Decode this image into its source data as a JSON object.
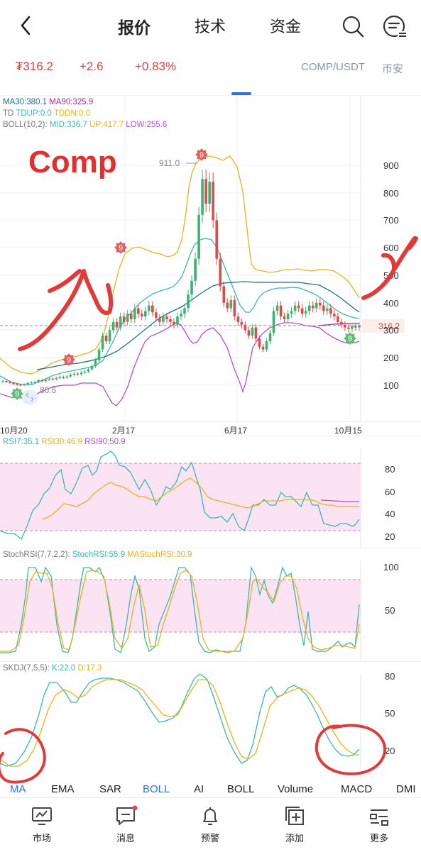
{
  "header": {
    "tabs": [
      {
        "label": "报价",
        "active": true
      },
      {
        "label": "技术",
        "active": false
      },
      {
        "label": "资金",
        "active": false
      }
    ]
  },
  "ticker": {
    "price": "₮316.2",
    "change": "+2.6",
    "change_pct": "+0.83%",
    "pair": "COMP/USDT",
    "exchange": "币安"
  },
  "main_chart": {
    "ma_line": {
      "ma30": "MA30:380.1",
      "ma90": "MA90:325.9"
    },
    "td_line": {
      "td": "TD",
      "tdup": "TDUP:0.0",
      "tddn": "TDDN:0.0"
    },
    "boll_line": {
      "boll": "BOLL(10,2):",
      "mid": "MID:336.7",
      "up": "UP:417.7",
      "low": "LOW:255.6"
    },
    "annotation": "Comp",
    "high_label": "911.0",
    "low_label": "80.6",
    "current_price_tag": "316.2",
    "td_markers": [
      "9",
      "9",
      "9",
      "9",
      "9"
    ],
    "y_ticks": [
      "900",
      "800",
      "700",
      "600",
      "500",
      "400",
      "300",
      "200",
      "100"
    ],
    "x_ticks": [
      "10月20",
      "2月17",
      "6月17",
      "10月15"
    ]
  },
  "rsi_panel": {
    "header": {
      "rsi7": "RSI7:35.1",
      "rsi30": "RSI30:46.9",
      "rsi90": "RSI90:50.9"
    },
    "y_ticks": [
      "80",
      "60",
      "40",
      "20"
    ]
  },
  "stochrsi_panel": {
    "header": {
      "title": "StochRSI(7,7,2,2):",
      "stoch": "StochRSI:55.9",
      "ma": "MAStochRSI:30.9"
    },
    "y_ticks": [
      "100",
      "50"
    ]
  },
  "skdj_panel": {
    "header": {
      "title": "SKDJ(7,5,5):",
      "k": "K:22.0",
      "d": "D:17.3"
    },
    "y_ticks": [
      "80",
      "50",
      "20"
    ]
  },
  "indicator_tabs": [
    "MA",
    "EMA",
    "SAR",
    "BOLL",
    "AI",
    "BOLL",
    "Volume",
    "MACD",
    "DMI"
  ],
  "bottom_nav": [
    {
      "label": "市场",
      "icon": "chart-monitor-icon"
    },
    {
      "label": "消息",
      "icon": "message-icon"
    },
    {
      "label": "预警",
      "icon": "bell-icon"
    },
    {
      "label": "添加",
      "icon": "add-icon"
    },
    {
      "label": "更多",
      "icon": "more-icon"
    }
  ],
  "colors": {
    "up": "#3cb371",
    "down": "#e04a4a",
    "ma30": "#1b6f8c",
    "ma90": "#9b2fa8",
    "boll_mid": "#39b8b0",
    "boll_up": "#e8b21a",
    "boll_low": "#b44fc6",
    "annotation": "#e03030",
    "accent": "#2f6fe0"
  }
}
